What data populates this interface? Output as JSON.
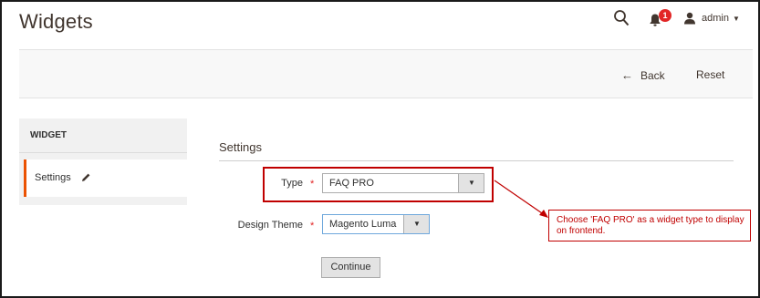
{
  "header": {
    "title": "Widgets",
    "notification_count": "1",
    "user": "admin",
    "icons": {
      "search": "search-icon",
      "bell": "bell-icon",
      "user": "user-icon",
      "dropdown": "chevron-down-icon"
    }
  },
  "actions": {
    "back_label": "Back",
    "reset_label": "Reset"
  },
  "tabs": {
    "header": "WIDGET",
    "items": [
      {
        "label": "Settings"
      }
    ]
  },
  "settings": {
    "title": "Settings",
    "fields": {
      "type": {
        "label": "Type",
        "value": "FAQ PRO",
        "required": true
      },
      "design_theme": {
        "label": "Design Theme",
        "value": "Magento Luma",
        "required": true
      }
    },
    "continue_label": "Continue"
  },
  "annotation": {
    "text": "Choose 'FAQ PRO' as a widget type to display on frontend."
  },
  "colors": {
    "accent": "#eb5202",
    "annotation": "#c00000",
    "badge": "#e22626",
    "action_bar": "#f8f8f8"
  }
}
